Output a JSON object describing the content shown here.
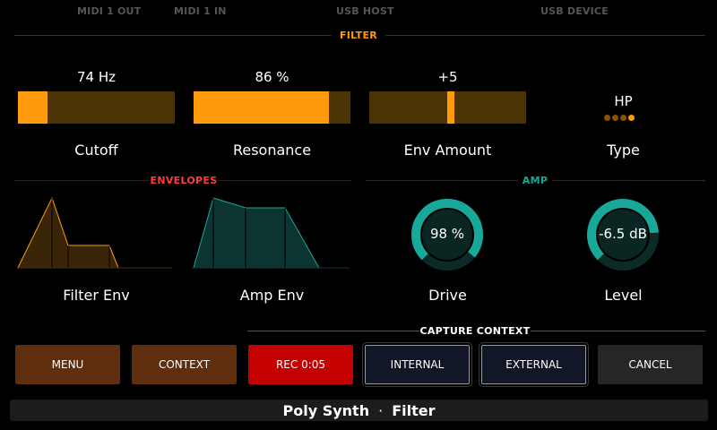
{
  "top_ports": [
    "MIDI 1 OUT",
    "MIDI 1 IN",
    "USB HOST",
    "USB DEVICE"
  ],
  "filter": {
    "title": "FILTER",
    "cutoff": {
      "value": "74 Hz",
      "label": "Cutoff",
      "level": 0.19
    },
    "resonance": {
      "value": "86 %",
      "label": "Resonance",
      "level": 0.86
    },
    "env_amount": {
      "value": "+5",
      "label": "Env Amount",
      "level": 0.52
    },
    "type": {
      "value": "HP",
      "label": "Type",
      "options_count": 4,
      "selected_index": 3
    }
  },
  "envelopes": {
    "title": "ENVELOPES",
    "filter_env_label": "Filter Env",
    "amp_env_label": "Amp Env"
  },
  "amp": {
    "title": "AMP",
    "drive": {
      "value": "98 %",
      "label": "Drive",
      "level": 0.98
    },
    "level": {
      "value": "-6.5 dB",
      "label": "Level",
      "level": 0.82
    }
  },
  "capture_context": {
    "title": "CAPTURE CONTEXT"
  },
  "buttons": {
    "menu": "MENU",
    "context": "CONTEXT",
    "rec": "REC 0:05",
    "internal": "INTERNAL",
    "external": "EXTERNAL",
    "cancel": "CANCEL"
  },
  "footer": {
    "app": "Poly Synth",
    "separator": "·",
    "page": "Filter"
  },
  "colors": {
    "orange": "#ff9b0c",
    "red_title": "#ff3b3b",
    "teal": "#17a89a",
    "rec_red": "#c40000"
  }
}
